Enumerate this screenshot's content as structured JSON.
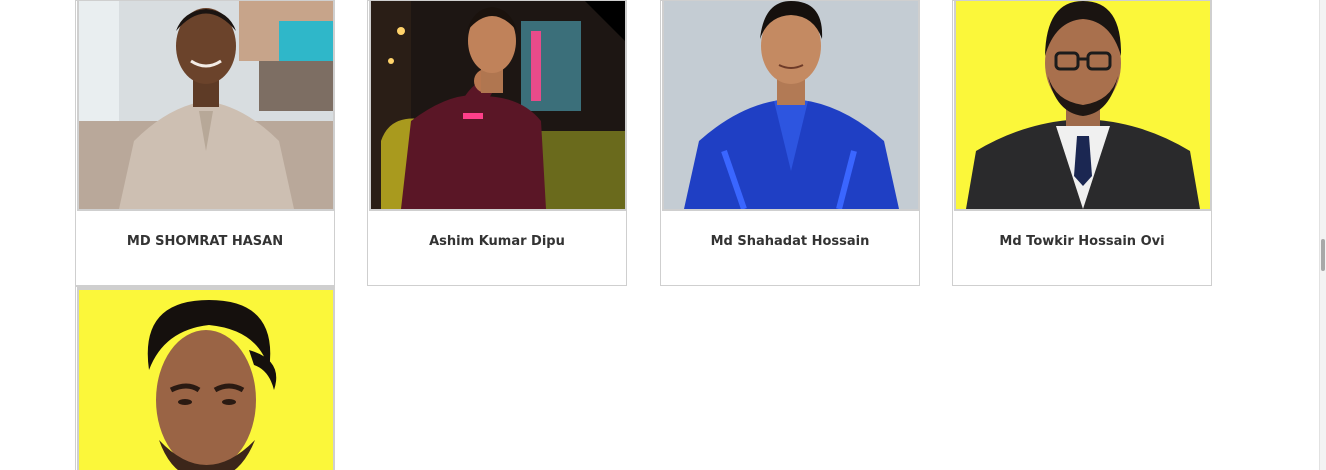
{
  "members": [
    {
      "name": "MD SHOMRAT HASAN",
      "photo_alt": "Portrait of MD SHOMRAT HASAN"
    },
    {
      "name": "Ashim Kumar Dipu",
      "photo_alt": "Portrait of Ashim Kumar Dipu"
    },
    {
      "name": "Md Shahadat Hossain",
      "photo_alt": "Portrait of Md Shahadat Hossain"
    },
    {
      "name": "Md Towkir Hossain Ovi",
      "photo_alt": "Portrait of Md Towkir Hossain Ovi"
    },
    {
      "name": "",
      "photo_alt": "Portrait of team member"
    }
  ],
  "colors": {
    "card_border": "#cfcfcf",
    "name_text": "#333333",
    "yellow_bg": "#fbf73a",
    "grey_bg": "#c4ccd3"
  }
}
